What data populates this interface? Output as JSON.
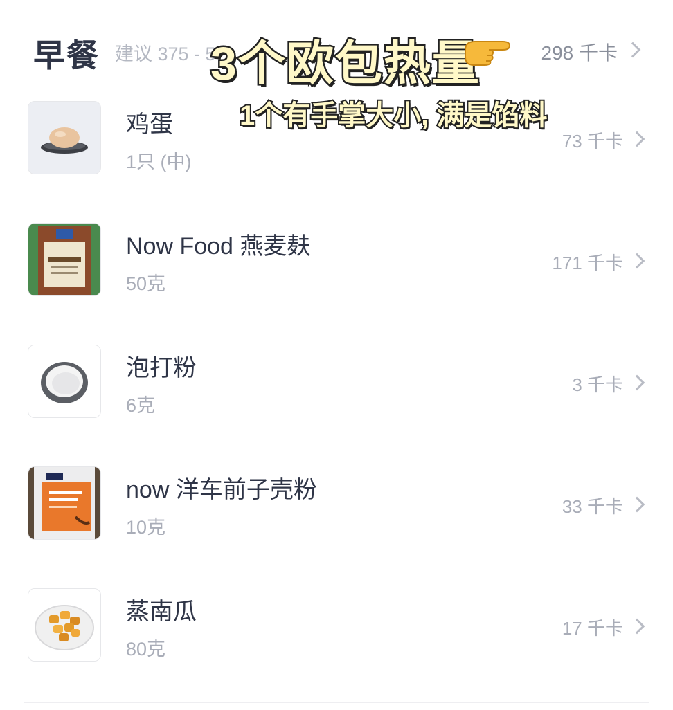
{
  "header": {
    "meal_title": "早餐",
    "suggestion": "建议 375 - 5",
    "total_kcal": "298 千卡"
  },
  "overlay": {
    "title": "3个欧包热量",
    "subtitle": "1个有手掌大小, 满是馅料",
    "icon": "pointing-hand-icon"
  },
  "items": [
    {
      "name": "鸡蛋",
      "amount": "1只 (中)",
      "kcal": "73 千卡",
      "icon": "egg-icon"
    },
    {
      "name": "Now Food 燕麦麸",
      "amount": "50克",
      "kcal": "171 千卡",
      "icon": "oat-bran-bag-icon"
    },
    {
      "name": "泡打粉",
      "amount": "6克",
      "kcal": "3 千卡",
      "icon": "baking-powder-bowl-icon"
    },
    {
      "name": "now 洋车前子壳粉",
      "amount": "10克",
      "kcal": "33 千卡",
      "icon": "psyllium-bag-icon"
    },
    {
      "name": "蒸南瓜",
      "amount": "80克",
      "kcal": "17 千卡",
      "icon": "steamed-pumpkin-icon"
    }
  ],
  "colors": {
    "text_primary": "#2f3547",
    "text_secondary": "#a9adb8",
    "overlay_fill": "#fff8c8"
  }
}
